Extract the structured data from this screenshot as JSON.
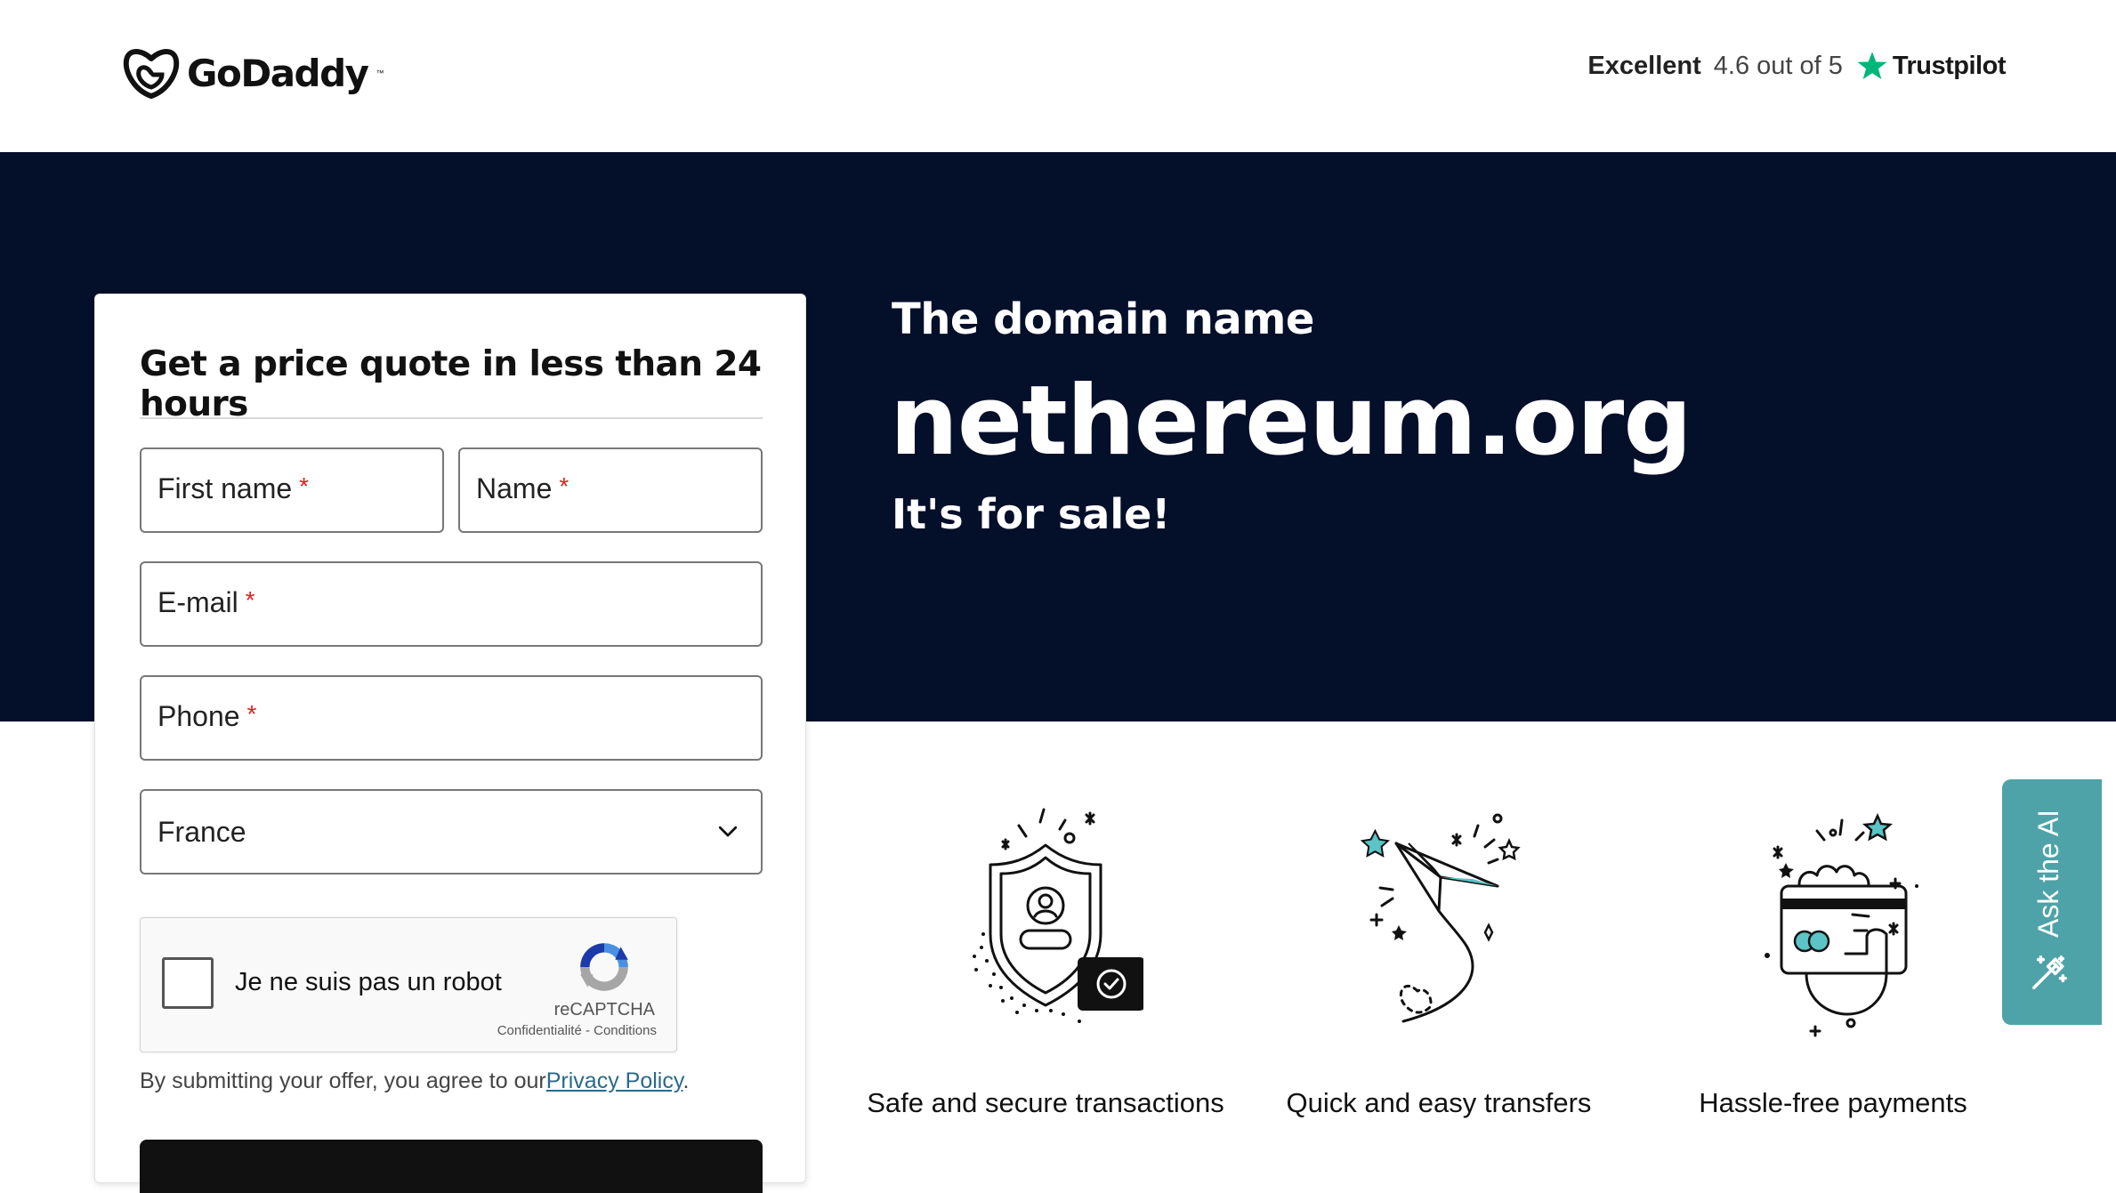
{
  "header": {
    "brand": "GoDaddy",
    "trustpilot": {
      "label": "Excellent",
      "rating": "4.6 out of 5",
      "brand": "Trustpilot",
      "star_color": "#00b67a"
    }
  },
  "hero": {
    "subtitle": "The domain name",
    "domain": "nethereum.org",
    "sale_text": "It's for sale!",
    "background": "#040f2a"
  },
  "form": {
    "title": "Get a price quote in less than 24 hours",
    "fields": {
      "first_name": "First name",
      "name": "Name",
      "email": "E-mail",
      "phone": "Phone"
    },
    "required_mark": "*",
    "country": "France",
    "captcha": {
      "label": "Je ne suis pas un robot",
      "brand": "reCAPTCHA",
      "links": "Confidentialité - Conditions"
    },
    "consent_prefix": "By submitting your offer, you agree to our",
    "consent_link": "Privacy Policy",
    "consent_suffix": "."
  },
  "features": [
    {
      "label": "Safe and secure transactions",
      "icon": "shield-icon"
    },
    {
      "label": "Quick and easy transfers",
      "icon": "paper-plane-icon"
    },
    {
      "label": "Hassle-free payments",
      "icon": "credit-card-hand-icon"
    }
  ],
  "ask_ai": {
    "label": "Ask the AI",
    "color": "#4ea3a8"
  }
}
